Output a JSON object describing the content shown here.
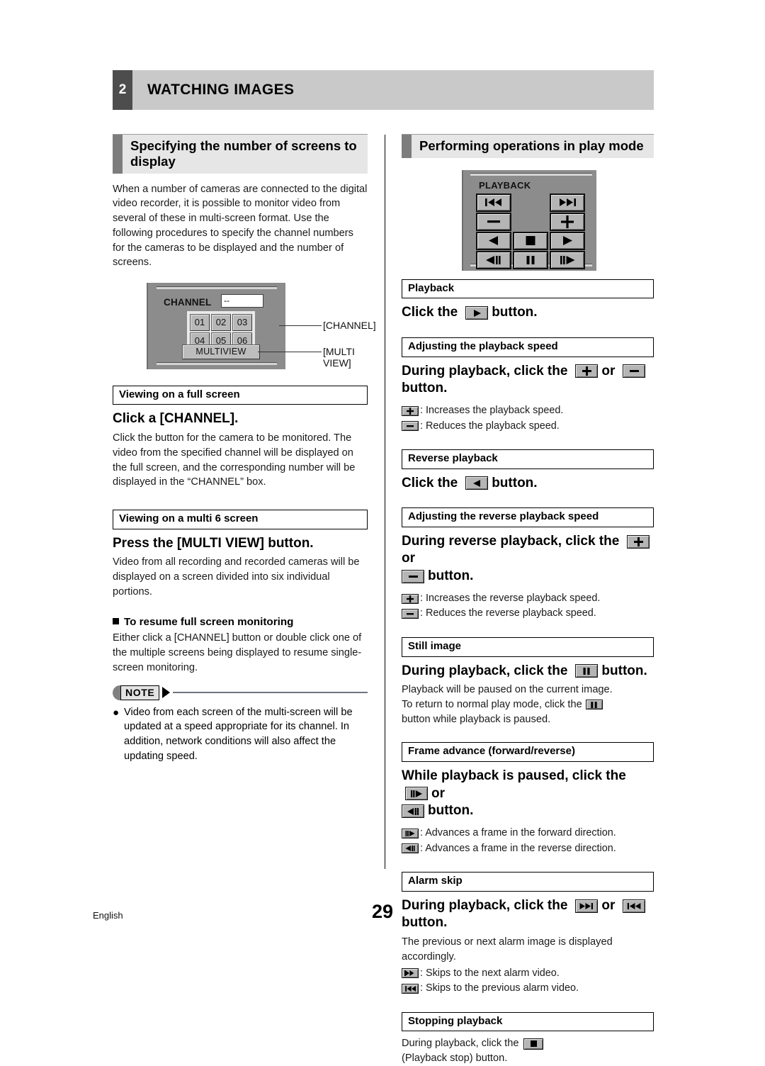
{
  "chapter": {
    "number": "2",
    "title": "WATCHING IMAGES"
  },
  "left": {
    "section_title": "Specifying the number of screens to display",
    "intro": "When a number of cameras are connected to the digital video recorder, it is possible to monitor video from several of these in multi-screen format. Use the following procedures to specify the channel numbers for the cameras to be displayed and the number of screens.",
    "channel_panel": {
      "label": "CHANNEL",
      "field_value": "--",
      "buttons": [
        "01",
        "02",
        "03",
        "04",
        "05",
        "06"
      ],
      "multiview_label": "MULTIVIEW",
      "callout_channel": "[CHANNEL]",
      "callout_multiview": "[MULTI VIEW]"
    },
    "fullscreen": {
      "heading": "Viewing on a full screen",
      "lead": "Click a [CHANNEL].",
      "body": "Click the button for the camera to be monitored. The video from the specified channel will be displayed on the full screen, and the corresponding number will be displayed in the “CHANNEL” box."
    },
    "multiscreen": {
      "heading": "Viewing on a multi 6 screen",
      "lead": "Press the [MULTI VIEW] button.",
      "body": "Video from all recording and recorded cameras will be displayed on a screen divided into six individual portions."
    },
    "resume": {
      "heading": "To resume full screen monitoring",
      "body": "Either click a [CHANNEL] button or double click one of the multiple screens being displayed to resume single-screen monitoring."
    },
    "note": {
      "badge": "NOTE",
      "bullet": "●",
      "text": "Video from each screen of the multi-screen will be updated at a speed appropriate for its channel. In addition, network conditions will also affect the updating speed."
    }
  },
  "right": {
    "section_title": "Performing operations in play mode",
    "playback_panel": {
      "title": "PLAYBACK",
      "buttons": [
        "skip-previous-icon",
        "",
        "skip-next-icon",
        "minus-icon",
        "",
        "plus-icon",
        "reverse-play-icon",
        "stop-icon",
        "play-icon",
        "frame-reverse-icon",
        "pause-icon",
        "frame-forward-icon"
      ]
    },
    "playback": {
      "heading": "Playback",
      "lead_pre": "Click the",
      "lead_post": "button.",
      "icon": "play-icon"
    },
    "speed": {
      "heading": "Adjusting the playback speed",
      "lead_pre": "During playback, click the",
      "lead_mid": "or",
      "lead_post": "button.",
      "icon_plus": "plus-icon",
      "icon_minus": "minus-icon",
      "def_plus": ": Increases the playback speed.",
      "def_minus": ": Reduces the playback speed."
    },
    "reverse": {
      "heading": "Reverse playback",
      "lead_pre": "Click the",
      "lead_post": "button.",
      "icon": "reverse-play-icon"
    },
    "reverse_speed": {
      "heading": "Adjusting the reverse playback speed",
      "lead_pre": "During reverse playback, click the",
      "lead_mid": "or",
      "lead_post": "button.",
      "icon_plus": "plus-icon",
      "icon_minus": "minus-icon",
      "def_plus": ": Increases the reverse playback speed.",
      "def_minus": ": Reduces the reverse playback speed."
    },
    "still": {
      "heading": "Still image",
      "lead_pre": "During playback, click the",
      "lead_post": "button.",
      "icon": "pause-icon",
      "body_1": "Playback will be paused on the current image.",
      "body_2a": "To return to normal play mode, click the",
      "body_2b": "button while playback is paused."
    },
    "frame": {
      "heading": "Frame advance (forward/reverse)",
      "lead_pre": "While playback is paused, click the",
      "lead_mid": "or",
      "lead_post": "button.",
      "icon_forward": "frame-forward-icon",
      "icon_reverse": "frame-reverse-icon",
      "def_forward": ": Advances a frame in the forward direction.",
      "def_reverse": ": Advances a frame in the reverse direction."
    },
    "alarm": {
      "heading": "Alarm skip",
      "lead_pre": "During playback, click the",
      "lead_mid": "or",
      "lead_post": "button.",
      "icon_next": "skip-next-icon",
      "icon_prev": "skip-previous-icon",
      "body": "The previous or next alarm image is displayed accordingly.",
      "def_next": ": Skips to the next alarm video.",
      "def_prev": ": Skips to the previous alarm video."
    },
    "stop": {
      "heading": "Stopping playback",
      "body_a": "During playback, click the",
      "body_b": "(Playback stop) button.",
      "icon": "stop-icon"
    }
  },
  "footer": {
    "language": "English",
    "page_number": "29"
  }
}
